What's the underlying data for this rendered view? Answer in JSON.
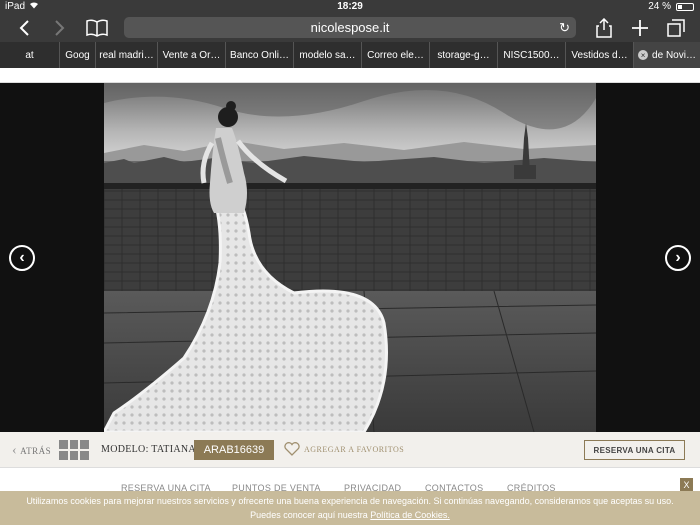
{
  "status": {
    "device": "iPad",
    "time": "18:29",
    "battery": "24 %",
    "battery_level": 0.24
  },
  "browser": {
    "url": "nicolespose.it",
    "tabs": [
      {
        "label": "at"
      },
      {
        "label": "Goog"
      },
      {
        "label": "real madri…"
      },
      {
        "label": "Vente a Or…"
      },
      {
        "label": "Banco Onli…"
      },
      {
        "label": "modelo sa…"
      },
      {
        "label": "Correo ele…"
      },
      {
        "label": "storage-g…"
      },
      {
        "label": "NISC1500…"
      },
      {
        "label": "Vestidos d…"
      },
      {
        "label": "de Novi…"
      }
    ]
  },
  "gallery": {
    "prev_arrow": "‹",
    "next_arrow": "›"
  },
  "model_bar": {
    "back_label": "ATRÁS",
    "model_label": "MODELO: TATIANA",
    "model_code": "ARAB16639",
    "favorite_label": "AGREGAR A FAVORITOS",
    "reserve_button": "RESERVA UNA CITA"
  },
  "footer_nav": {
    "items": [
      "RESERVA UNA CITA",
      "PUNTOS DE VENTA",
      "PRIVACIDAD",
      "CONTACTOS",
      "CRÉDITOS"
    ]
  },
  "cookie": {
    "text": "Utilizamos cookies para mejorar nuestros servicios y ofrecerte una buena experiencia de navegación. Si continúas navegando, consideramos que aceptas su uso.",
    "text2": "Puedes conocer aquí nuestra",
    "link": "Política de Cookies.",
    "close": "X"
  },
  "colors": {
    "accent": "#8c7a55",
    "cookie_bg": "#c8bb9b",
    "chrome": "#3a3a3a"
  }
}
